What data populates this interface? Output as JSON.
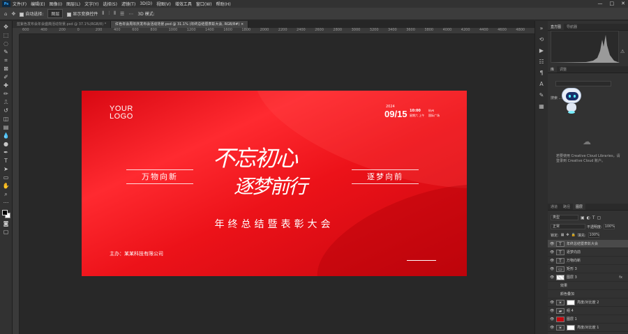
{
  "menu": {
    "logo": "Ps",
    "items": [
      "文件(F)",
      "编辑(E)",
      "图像(I)",
      "图层(L)",
      "文字(Y)",
      "选择(S)",
      "滤镜(T)",
      "3D(D)",
      "视图(V)",
      "增效工具",
      "窗口(W)",
      "帮助(H)"
    ],
    "minimize": "—",
    "maximize": "□",
    "close": "✕"
  },
  "options": {
    "auto_select": "自动选择:",
    "layer_select": "图层",
    "show_transform": "显示变换控件",
    "mode3d": "3D 模式:"
  },
  "tabs": [
    "蓝紫色发布会年会盛典活动背景.psd @ 37.1%(RGB/8) *",
    "红色年会周年庆发布会活动背景.psd @ 31.1% (年终总结暨表彰大会, RGB/8#) ×"
  ],
  "ruler_ticks": [
    "600",
    "400",
    "200",
    "0",
    "200",
    "400",
    "600",
    "800",
    "1000",
    "1200",
    "1400",
    "1600",
    "1800",
    "2000",
    "2200",
    "2400",
    "2600",
    "2800",
    "3000",
    "3200",
    "3400",
    "3600",
    "3800",
    "4000",
    "4200",
    "4400",
    "4600",
    "4800",
    "5000"
  ],
  "artwork": {
    "logo_line1": "YOUR",
    "logo_line2": "LOGO",
    "year": "2024",
    "date": "09/15",
    "time": "10:00",
    "time_zone": "星期六 上午",
    "city": "杭州",
    "venue": "国际广场",
    "left_box": "万物向新",
    "right_box": "逐梦向前",
    "calligraphy_line1": "不忘初心",
    "calligraphy_line2": "逐梦前行",
    "subtitle": "年终总结暨表彰大会",
    "host": "主办：某某科技有限公司"
  },
  "panels": {
    "top_tabs": [
      "直方图",
      "导航器"
    ],
    "lib_tabs": [
      "库",
      "调整"
    ],
    "lib_label": "搜索 ...",
    "cc_text": "若要使用 Creative Cloud Libraries，请登录到 Creative Cloud 账户。",
    "layer_tabs": [
      "通道",
      "路径",
      "图层"
    ],
    "kind": "类型",
    "blend": "正常",
    "opacity_label": "不透明度:",
    "opacity": "100%",
    "lock_label": "锁定:",
    "fill_label": "填充:",
    "fill": "100%"
  },
  "layers": [
    {
      "name": "年终总结暨表彰大会",
      "type": "T",
      "selected": true
    },
    {
      "name": "逐梦向前",
      "type": "T",
      "selected": false
    },
    {
      "name": "万物向新",
      "type": "T",
      "selected": false
    },
    {
      "name": "矩形 3",
      "type": "rect",
      "selected": false
    },
    {
      "name": "图层 3",
      "type": "checker",
      "fx": "fx",
      "selected": false
    },
    {
      "name": "效果",
      "type": "sub",
      "selected": false
    },
    {
      "name": "颜色叠加",
      "type": "sub",
      "selected": false
    },
    {
      "name": "亮度/对比度 2",
      "type": "adj",
      "selected": false
    },
    {
      "name": "组 4",
      "type": "group",
      "selected": false
    },
    {
      "name": "图层 1",
      "type": "red",
      "selected": false
    },
    {
      "name": "亮度/对比度 1",
      "type": "adj",
      "selected": false
    }
  ],
  "colors": {
    "artwork_red": "#e8131c",
    "panel_bg": "#323232",
    "canvas_bg": "#282828"
  }
}
